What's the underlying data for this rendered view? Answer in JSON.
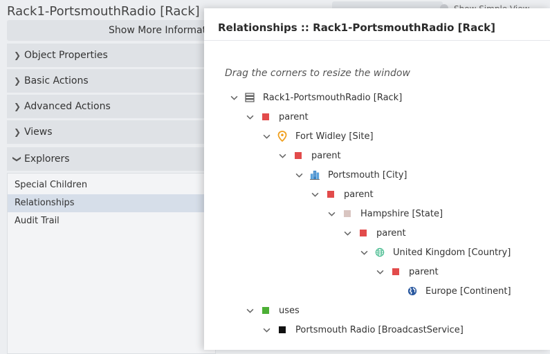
{
  "background": {
    "title": "Rack1-PortsmouthRadio [Rack]",
    "show_more": "Show More Informatio",
    "top_right_text": "Show Simple View",
    "accordion": [
      {
        "label": "Object Properties"
      },
      {
        "label": "Basic Actions"
      },
      {
        "label": "Advanced Actions"
      },
      {
        "label": "Views"
      },
      {
        "label": "Explorers"
      }
    ],
    "explorers": [
      {
        "label": "Special Children"
      },
      {
        "label": "Relationships"
      },
      {
        "label": "Audit Trail"
      }
    ]
  },
  "modal": {
    "title": "Relationships :: Rack1-PortsmouthRadio [Rack]",
    "hint": "Drag the corners to resize the window",
    "tree": [
      {
        "label": "Rack1-PortsmouthRadio [Rack]",
        "icon": "rack-icon",
        "expanded": true
      },
      {
        "label": "parent",
        "icon": "square-icon",
        "color": "#e24b4b",
        "expanded": true
      },
      {
        "label": "Fort Widley [Site]",
        "icon": "location-pin-icon",
        "color": "#f0a020",
        "expanded": true
      },
      {
        "label": "parent",
        "icon": "square-icon",
        "color": "#e24b4b",
        "expanded": true
      },
      {
        "label": "Portsmouth [City]",
        "icon": "city-buildings-icon",
        "color": "#3a86c8",
        "expanded": true
      },
      {
        "label": "parent",
        "icon": "square-icon",
        "color": "#e24b4b",
        "expanded": true
      },
      {
        "label": "Hampshire [State]",
        "icon": "square-icon",
        "color": "#d9c5c1",
        "expanded": true
      },
      {
        "label": "parent",
        "icon": "square-icon",
        "color": "#e24b4b",
        "expanded": true
      },
      {
        "label": "United Kingdom [Country]",
        "icon": "globe-outline-icon",
        "color": "#3fb88a",
        "expanded": true
      },
      {
        "label": "parent",
        "icon": "square-icon",
        "color": "#e24b4b",
        "expanded": true
      },
      {
        "label": "Europe [Continent]",
        "icon": "earth-icon",
        "color": "#2c5aa0",
        "expanded": false
      },
      {
        "label": "uses",
        "icon": "square-icon",
        "color": "#4caf35",
        "expanded": true
      },
      {
        "label": "Portsmouth Radio [BroadcastService]",
        "icon": "square-icon",
        "color": "#111111",
        "expanded": true
      }
    ]
  }
}
